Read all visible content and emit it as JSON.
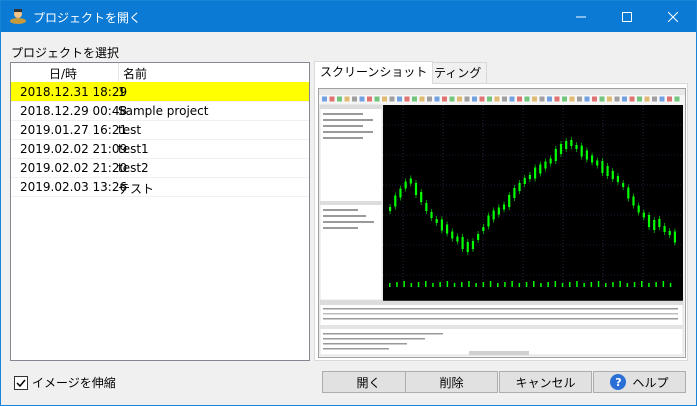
{
  "window": {
    "title": "プロジェクトを開く",
    "controls": {
      "minimize": "minimize",
      "maximize": "maximize",
      "close": "close"
    }
  },
  "select_label": "プロジェクトを選択",
  "list": {
    "columns": [
      "日/時",
      "名前"
    ],
    "rows": [
      {
        "date": "2018.12.31 18:29",
        "name": "1",
        "selected": true
      },
      {
        "date": "2018.12.29 00:48",
        "name": "Sample project",
        "selected": false
      },
      {
        "date": "2019.01.27 16:21",
        "name": "test",
        "selected": false
      },
      {
        "date": "2019.02.02 21:09",
        "name": "test1",
        "selected": false
      },
      {
        "date": "2019.02.02 21:20",
        "name": "test2",
        "selected": false
      },
      {
        "date": "2019.02.03 13:26",
        "name": "テスト",
        "selected": false
      }
    ]
  },
  "tabs": [
    {
      "label": "スクリーンショット",
      "active": true
    },
    {
      "label": "セッティング",
      "active": false
    }
  ],
  "stretch_checkbox": {
    "label": "イメージを伸縮",
    "checked": true
  },
  "buttons": {
    "open": "開く",
    "delete": "削除",
    "cancel": "キャンセル",
    "help": "ヘルプ"
  },
  "colors": {
    "titlebar": "#0a7ad4",
    "selected_row": "#ffff00",
    "chart_bg": "#000000",
    "candle": "#00ff00"
  }
}
